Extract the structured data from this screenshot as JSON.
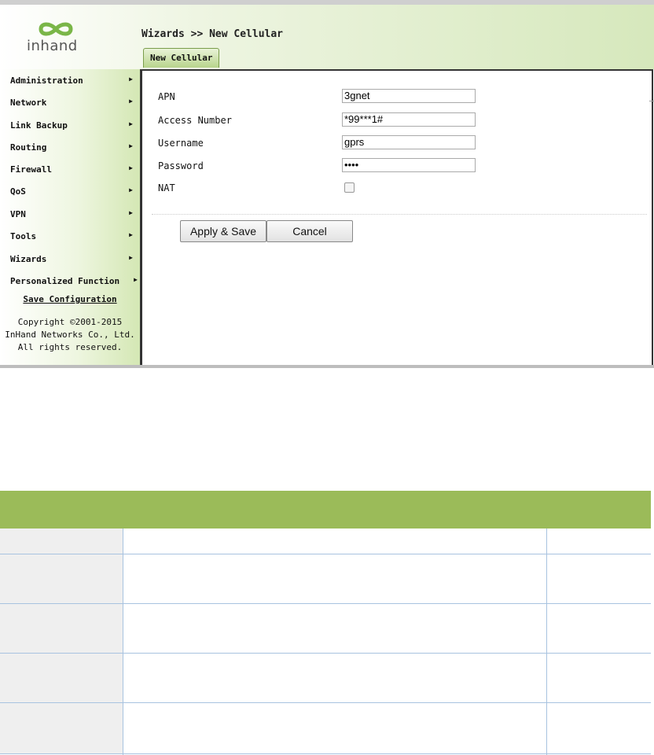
{
  "header": {
    "logo_text": "inhand",
    "breadcrumb": "Wizards >> New Cellular",
    "tab_label": "New Cellular"
  },
  "sidebar": {
    "items": [
      {
        "label": "Administration"
      },
      {
        "label": "Network"
      },
      {
        "label": "Link Backup"
      },
      {
        "label": "Routing"
      },
      {
        "label": "Firewall"
      },
      {
        "label": "QoS"
      },
      {
        "label": "VPN"
      },
      {
        "label": "Tools"
      },
      {
        "label": "Wizards"
      },
      {
        "label": "Personalized Function"
      }
    ],
    "save_label": "Save Configuration",
    "copyright_1": "Copyright ©2001-2015",
    "copyright_2": "InHand Networks Co., Ltd.",
    "copyright_3": "All rights reserved."
  },
  "form": {
    "apn_label": "APN",
    "apn_value": "3gnet",
    "access_label": "Access Number",
    "access_value": "*99***1#",
    "username_label": "Username",
    "username_value": "gprs",
    "password_label": "Password",
    "password_value": "••••",
    "nat_label": "NAT",
    "nat_checked": false
  },
  "buttons": {
    "apply_label": "Apply & Save",
    "cancel_label": "Cancel"
  },
  "colors": {
    "table_header": "#9bbb59",
    "accent_green": "#b8d48c"
  }
}
